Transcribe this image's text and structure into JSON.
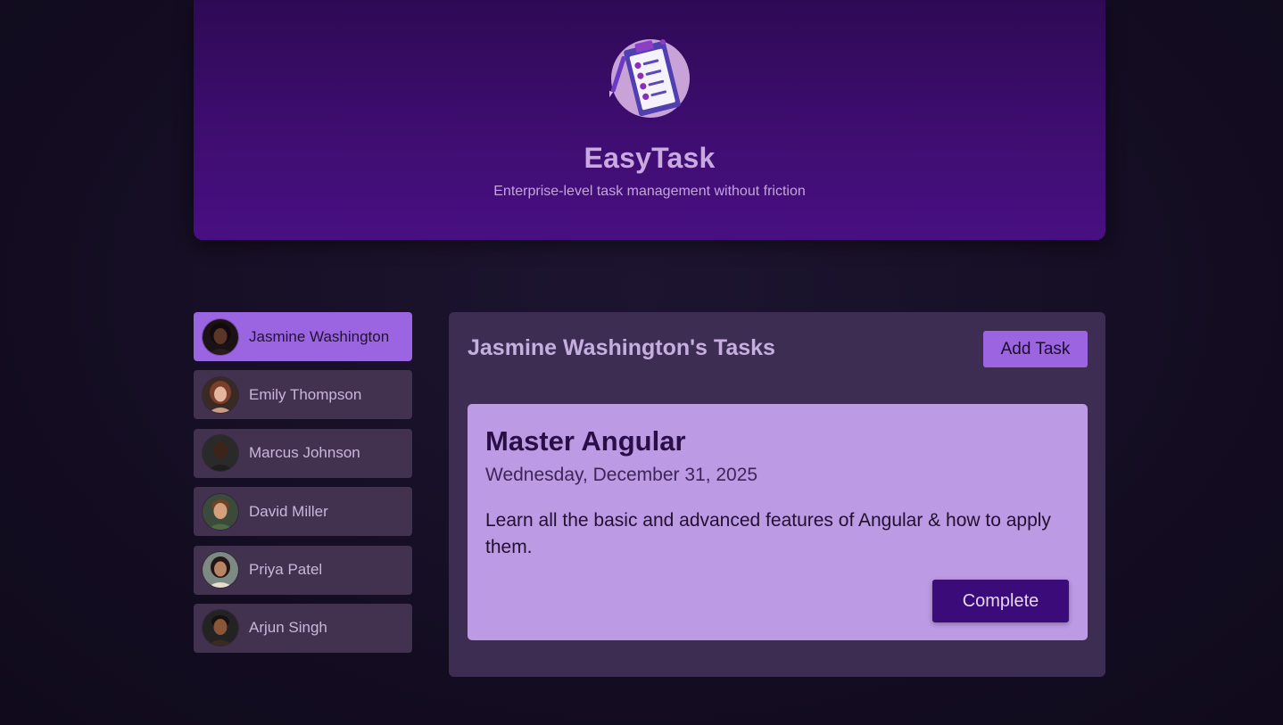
{
  "header": {
    "logo_icon": "clipboard-checklist-icon",
    "title": "EasyTask",
    "tagline": "Enterprise-level task management without friction"
  },
  "users": [
    {
      "name": "Jasmine Washington",
      "selected": true
    },
    {
      "name": "Emily Thompson",
      "selected": false
    },
    {
      "name": "Marcus Johnson",
      "selected": false
    },
    {
      "name": "David Miller",
      "selected": false
    },
    {
      "name": "Priya Patel",
      "selected": false
    },
    {
      "name": "Arjun Singh",
      "selected": false
    }
  ],
  "tasks": {
    "heading": "Jasmine Washington's Tasks",
    "add_label": "Add Task",
    "items": [
      {
        "title": "Master Angular",
        "date": "Wednesday, December 31, 2025",
        "summary": "Learn all the basic and advanced features of Angular & how to apply them.",
        "complete_label": "Complete"
      }
    ]
  },
  "colors": {
    "page_background": "#130d22",
    "header_gradient_top": "#2e0a55",
    "header_gradient_bottom": "#480f82",
    "accent": "#9b64e0",
    "panel": "#3d2d52",
    "user_item": "#42324f",
    "card": "#bd9ae4",
    "complete_button": "#3b0b79"
  }
}
